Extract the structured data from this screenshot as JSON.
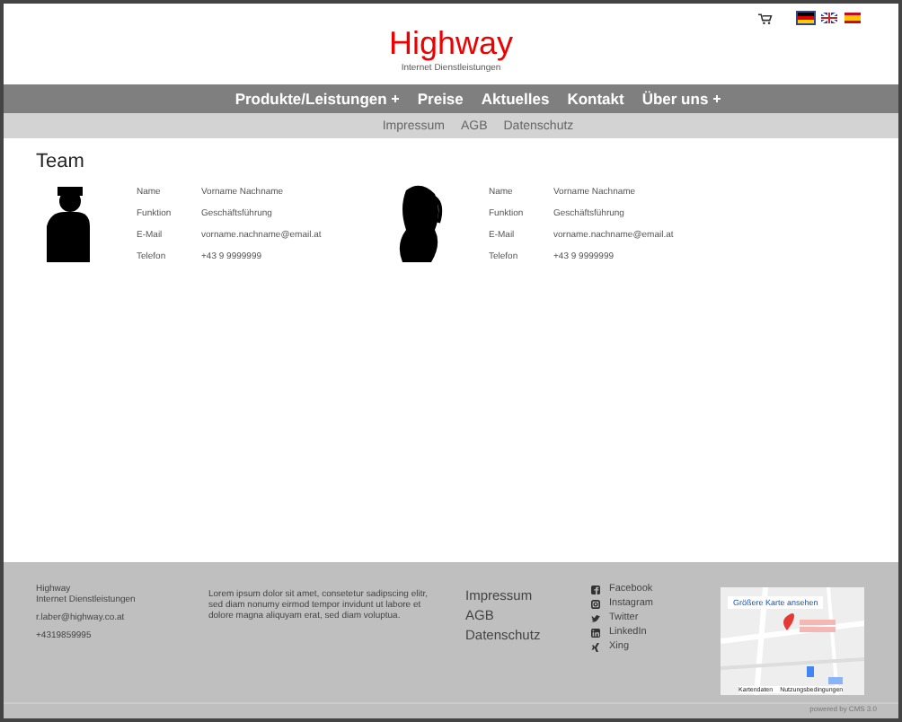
{
  "header": {
    "title": "Highway",
    "subtitle": "Internet Dienstleistungen",
    "flags": [
      {
        "kind": "de",
        "selected": true
      },
      {
        "kind": "uk",
        "selected": false
      },
      {
        "kind": "es",
        "selected": false
      }
    ]
  },
  "nav": [
    {
      "label": "Produkte/Leistungen",
      "submenu": true
    },
    {
      "label": "Preise",
      "submenu": false
    },
    {
      "label": "Aktuelles",
      "submenu": false
    },
    {
      "label": "Kontakt",
      "submenu": false
    },
    {
      "label": "Über uns",
      "submenu": true
    }
  ],
  "subnav": [
    "Impressum",
    "AGB",
    "Datenschutz"
  ],
  "team": {
    "heading": "Team",
    "members": [
      {
        "kind": "man",
        "fields": [
          {
            "label": "Name",
            "value": "Vorname Nachname"
          },
          {
            "label": "Funktion",
            "value": "Geschäftsführung"
          },
          {
            "label": "E-Mail",
            "value": "vorname.nachname@email.at"
          },
          {
            "label": "Telefon",
            "value": "+43 9 9999999"
          }
        ]
      },
      {
        "kind": "woman",
        "fields": [
          {
            "label": "Name",
            "value": "Vorname Nachname"
          },
          {
            "label": "Funktion",
            "value": "Geschäftsführung"
          },
          {
            "label": "E-Mail",
            "value": "vorname.nachname@email.at"
          },
          {
            "label": "Telefon",
            "value": "+43 9 9999999"
          }
        ]
      }
    ]
  },
  "footer": {
    "company": "Highway",
    "company_sub": "Internet Dienstleistungen",
    "email": "r.laber@highway.co.at",
    "phone": "+4319859995",
    "text": "Lorem ipsum dolor sit amet, consetetur sadipscing elitr, sed diam nonumy eirmod tempor invidunt ut labore et dolore magna aliquyam erat, sed diam voluptua.",
    "links": [
      "Impressum",
      "AGB",
      "Datenschutz"
    ],
    "social": [
      {
        "kind": "facebook",
        "label": "Facebook"
      },
      {
        "kind": "instagram",
        "label": "Instagram"
      },
      {
        "kind": "twitter",
        "label": "Twitter"
      },
      {
        "kind": "linkedin",
        "label": "LinkedIn"
      },
      {
        "kind": "xing",
        "label": "Xing"
      }
    ],
    "map": {
      "button": "Größere Karte ansehen",
      "links": [
        "Kartendaten",
        "Nutzungsbedingungen"
      ]
    },
    "powered": "powered by CMS 3.0"
  }
}
